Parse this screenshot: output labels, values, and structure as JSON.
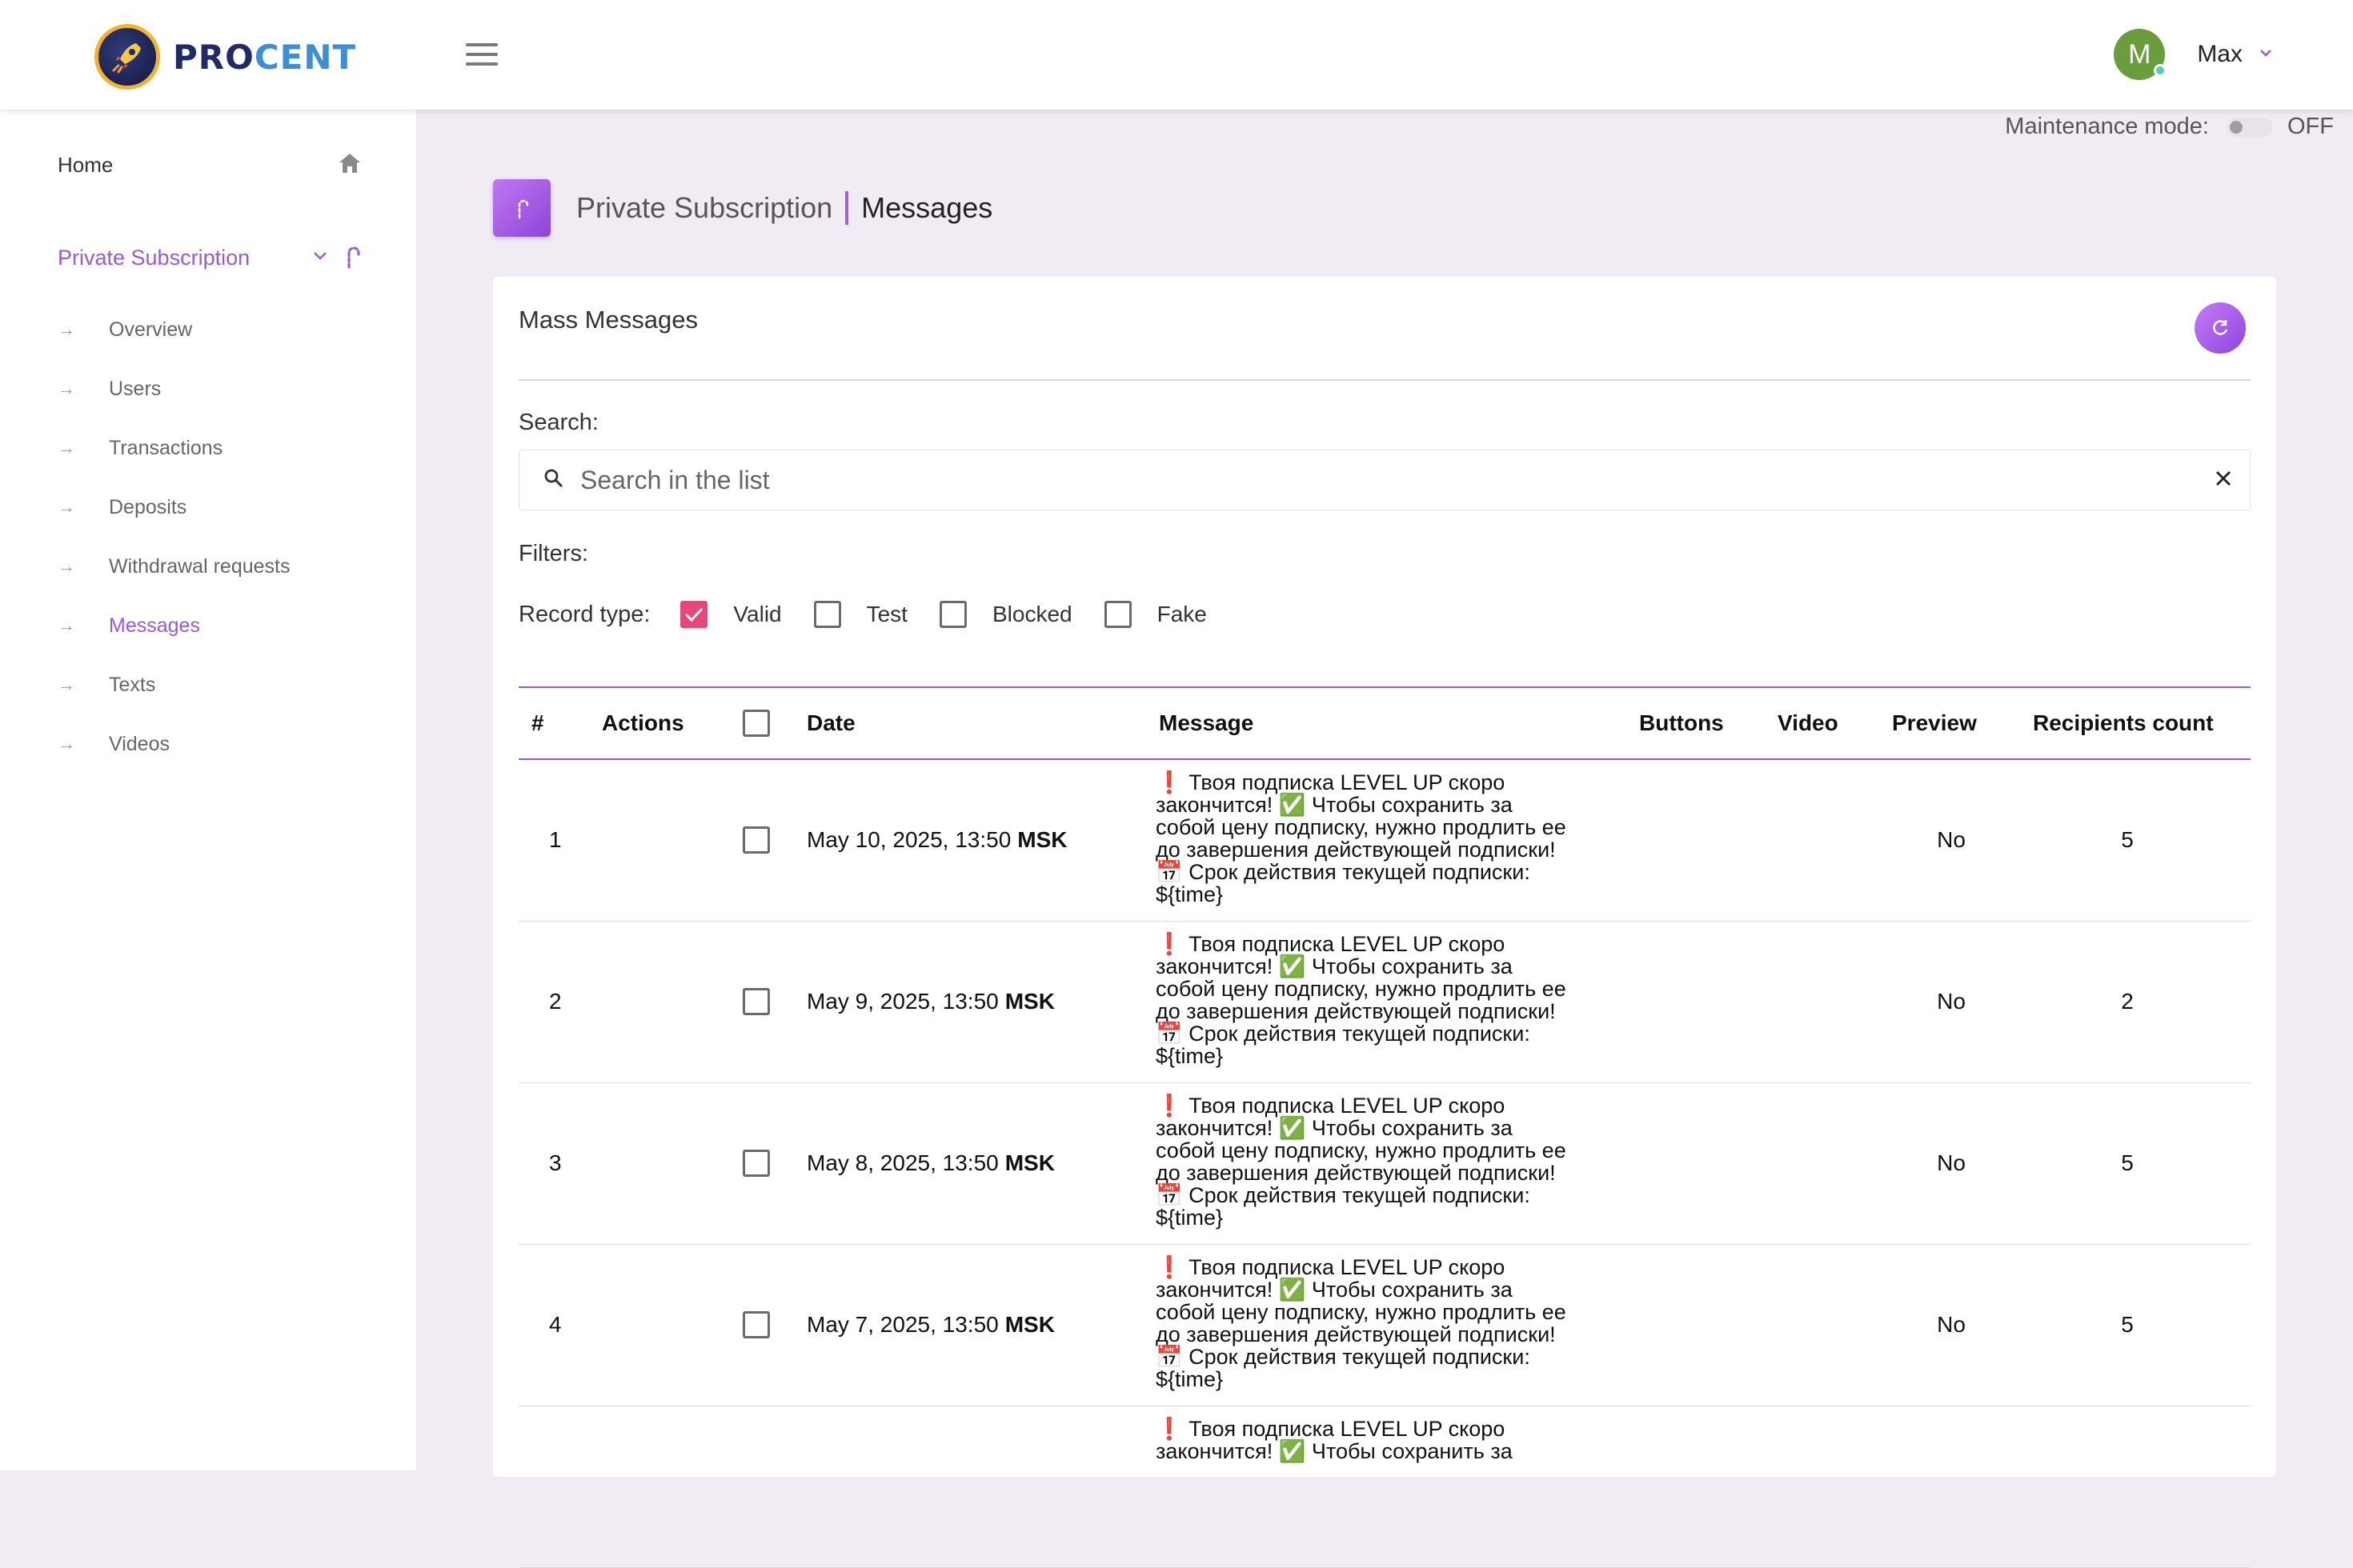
{
  "header": {
    "logo_pro": "PRO",
    "logo_cent": "CENT",
    "user_initial": "M",
    "user_name": "Max"
  },
  "sidebar": {
    "home_label": "Home",
    "section_label": "Private Subscription",
    "items": [
      {
        "label": "Overview"
      },
      {
        "label": "Users"
      },
      {
        "label": "Transactions"
      },
      {
        "label": "Deposits"
      },
      {
        "label": "Withdrawal requests"
      },
      {
        "label": "Messages",
        "active": true
      },
      {
        "label": "Texts"
      },
      {
        "label": "Videos"
      }
    ]
  },
  "maintenance": {
    "label": "Maintenance mode:",
    "state": "OFF"
  },
  "page": {
    "breadcrumb": "Private Subscription",
    "title": "Messages"
  },
  "card": {
    "title": "Mass Messages",
    "search_label": "Search:",
    "search_placeholder": "Search in the list",
    "filters_label": "Filters:",
    "record_type_label": "Record type:",
    "record_types": [
      {
        "label": "Valid",
        "checked": true
      },
      {
        "label": "Test",
        "checked": false
      },
      {
        "label": "Blocked",
        "checked": false
      },
      {
        "label": "Fake",
        "checked": false
      }
    ]
  },
  "table": {
    "columns": [
      "#",
      "Actions",
      "",
      "Date",
      "Message",
      "Buttons",
      "Video",
      "Preview",
      "Recipients count"
    ],
    "rows": [
      {
        "num": "1",
        "date": "May 10, 2025, 13:50",
        "tz": "MSK",
        "message": "❗ Твоя подписка LEVEL UP скоро\nзакончится! ✅ Чтобы сохранить за\nсобой цену подписку, нужно продлить ее\nдо завершения действующей подписки!\n📅 Срок действия текущей подписки:\n${time}",
        "preview": "No",
        "recipients": "5"
      },
      {
        "num": "2",
        "date": "May 9, 2025, 13:50",
        "tz": "MSK",
        "message": "❗ Твоя подписка LEVEL UP скоро\nзакончится! ✅ Чтобы сохранить за\nсобой цену подписку, нужно продлить ее\nдо завершения действующей подписки!\n📅 Срок действия текущей подписки:\n${time}",
        "preview": "No",
        "recipients": "2"
      },
      {
        "num": "3",
        "date": "May 8, 2025, 13:50",
        "tz": "MSK",
        "message": "❗ Твоя подписка LEVEL UP скоро\nзакончится! ✅ Чтобы сохранить за\nсобой цену подписку, нужно продлить ее\nдо завершения действующей подписки!\n📅 Срок действия текущей подписки:\n${time}",
        "preview": "No",
        "recipients": "5"
      },
      {
        "num": "4",
        "date": "May 7, 2025, 13:50",
        "tz": "MSK",
        "message": "❗ Твоя подписка LEVEL UP скоро\nзакончится! ✅ Чтобы сохранить за\nсобой цену подписку, нужно продлить ее\nдо завершения действующей подписки!\n📅 Срок действия текущей подписки:\n${time}",
        "preview": "No",
        "recipients": "5"
      },
      {
        "num": "",
        "date": "",
        "tz": "",
        "message": "❗ Твоя подписка LEVEL UP скоро\nзакончится! ✅ Чтобы сохранить за",
        "preview": "",
        "recipients": ""
      }
    ]
  },
  "colors": {
    "accent": "#9b59d6",
    "checkbox_checked": "#e8457a",
    "avatar": "#6a9d3b"
  }
}
